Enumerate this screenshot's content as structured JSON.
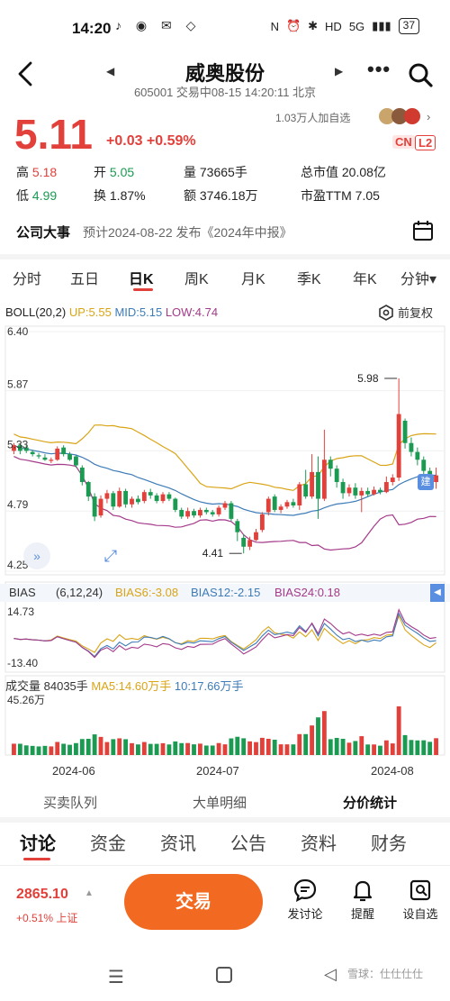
{
  "status": {
    "time": "14:20",
    "network": "5G",
    "battery": "37"
  },
  "header": {
    "stock_name": "威奥股份",
    "sub": "605001 交易中08-15 14:20:11 北京"
  },
  "quote": {
    "price": "5.11",
    "change": "+0.03 +0.59%",
    "watchers": "1.03万人加自选",
    "tag_cn": "CN",
    "tag_l2": "L2"
  },
  "metrics": {
    "high_label": "高",
    "high": "5.18",
    "open_label": "开",
    "open": "5.05",
    "volume": "量 73665手",
    "market_cap": "总市值 20.08亿",
    "low_label": "低",
    "low": "4.99",
    "turnover": "换 1.87%",
    "amount": "额 3746.18万",
    "pe": "市盈TTM 7.05"
  },
  "event": {
    "title": "公司大事",
    "text": "预计2024-08-22 发布《2024年中报》"
  },
  "period_tabs": [
    "分时",
    "五日",
    "日K",
    "周K",
    "月K",
    "季K",
    "年K",
    "分钟▾"
  ],
  "chart": {
    "boll_name": "BOLL(20,2)",
    "boll_up": "UP:5.55",
    "boll_mid": "MID:5.15",
    "boll_low": "LOW:4.74",
    "fq": "前复权",
    "bias_name": "BIAS",
    "bias_params": "(6,12,24)",
    "bias6": "BIAS6:-3.08",
    "bias12": "BIAS12:-2.15",
    "bias24": "BIAS24:0.18",
    "vol_name": "成交量",
    "vol_val": "84035手",
    "vol_ma5": "MA5:14.60万手",
    "vol_ma10": "10:17.66万手",
    "build_badge": "建"
  },
  "chart_data": {
    "type": "candlestick",
    "price_axis_ticks": [
      "6.40",
      "5.87",
      "5.33",
      "4.79",
      "4.25"
    ],
    "ylim": [
      4.25,
      6.4
    ],
    "annotations": [
      {
        "label": "5.98",
        "value": 5.98
      },
      {
        "label": "4.41",
        "value": 4.41
      }
    ],
    "bias_axis_ticks": [
      "14.73",
      "-13.40"
    ],
    "volume_axis_ticks": [
      "45.26万"
    ],
    "x_tick_labels": [
      "2024-06",
      "2024-07",
      "2024-08"
    ],
    "candles": [
      {
        "o": 5.33,
        "c": 5.38,
        "h": 5.4,
        "l": 5.3
      },
      {
        "o": 5.38,
        "c": 5.33,
        "h": 5.4,
        "l": 5.3
      },
      {
        "o": 5.36,
        "c": 5.33,
        "h": 5.38,
        "l": 5.31
      },
      {
        "o": 5.32,
        "c": 5.3,
        "h": 5.34,
        "l": 5.28
      },
      {
        "o": 5.29,
        "c": 5.28,
        "h": 5.31,
        "l": 5.26
      },
      {
        "o": 5.27,
        "c": 5.25,
        "h": 5.3,
        "l": 5.24
      },
      {
        "o": 5.24,
        "c": 5.25,
        "h": 5.27,
        "l": 5.22
      },
      {
        "o": 5.25,
        "c": 5.35,
        "h": 5.37,
        "l": 5.24
      },
      {
        "o": 5.36,
        "c": 5.3,
        "h": 5.38,
        "l": 5.28
      },
      {
        "o": 5.3,
        "c": 5.25,
        "h": 5.32,
        "l": 5.24
      },
      {
        "o": 5.28,
        "c": 5.2,
        "h": 5.29,
        "l": 5.18
      },
      {
        "o": 5.18,
        "c": 5.05,
        "h": 5.2,
        "l": 5.02
      },
      {
        "o": 5.05,
        "c": 4.92,
        "h": 5.06,
        "l": 4.88
      },
      {
        "o": 4.92,
        "c": 4.74,
        "h": 4.95,
        "l": 4.7
      },
      {
        "o": 4.75,
        "c": 4.9,
        "h": 4.93,
        "l": 4.73
      },
      {
        "o": 4.9,
        "c": 4.95,
        "h": 4.98,
        "l": 4.86
      },
      {
        "o": 4.95,
        "c": 4.83,
        "h": 4.97,
        "l": 4.8
      },
      {
        "o": 4.83,
        "c": 4.97,
        "h": 5.0,
        "l": 4.82
      },
      {
        "o": 4.97,
        "c": 4.85,
        "h": 4.99,
        "l": 4.82
      },
      {
        "o": 4.85,
        "c": 4.9,
        "h": 4.92,
        "l": 4.82
      },
      {
        "o": 4.9,
        "c": 4.87,
        "h": 4.93,
        "l": 4.85
      },
      {
        "o": 4.88,
        "c": 4.96,
        "h": 4.98,
        "l": 4.86
      },
      {
        "o": 4.96,
        "c": 4.93,
        "h": 4.99,
        "l": 4.9
      },
      {
        "o": 4.93,
        "c": 4.88,
        "h": 4.95,
        "l": 4.86
      },
      {
        "o": 4.88,
        "c": 4.94,
        "h": 4.96,
        "l": 4.86
      },
      {
        "o": 4.94,
        "c": 4.9,
        "h": 4.96,
        "l": 4.88
      },
      {
        "o": 4.9,
        "c": 4.8,
        "h": 4.91,
        "l": 4.78
      },
      {
        "o": 4.8,
        "c": 4.74,
        "h": 4.82,
        "l": 4.72
      },
      {
        "o": 4.74,
        "c": 4.79,
        "h": 4.82,
        "l": 4.72
      },
      {
        "o": 4.79,
        "c": 4.75,
        "h": 4.81,
        "l": 4.73
      },
      {
        "o": 4.75,
        "c": 4.8,
        "h": 4.82,
        "l": 4.73
      },
      {
        "o": 4.8,
        "c": 4.78,
        "h": 4.82,
        "l": 4.76
      },
      {
        "o": 4.78,
        "c": 4.76,
        "h": 4.8,
        "l": 4.74
      },
      {
        "o": 4.76,
        "c": 4.82,
        "h": 4.84,
        "l": 4.74
      },
      {
        "o": 4.82,
        "c": 4.86,
        "h": 4.88,
        "l": 4.8
      },
      {
        "o": 4.86,
        "c": 4.72,
        "h": 4.88,
        "l": 4.7
      },
      {
        "o": 4.7,
        "c": 4.6,
        "h": 4.72,
        "l": 4.52
      },
      {
        "o": 4.55,
        "c": 4.47,
        "h": 4.58,
        "l": 4.41
      },
      {
        "o": 4.47,
        "c": 4.53,
        "h": 4.56,
        "l": 4.44
      },
      {
        "o": 4.53,
        "c": 4.6,
        "h": 4.63,
        "l": 4.52
      },
      {
        "o": 4.62,
        "c": 4.76,
        "h": 4.78,
        "l": 4.6
      },
      {
        "o": 4.78,
        "c": 4.9,
        "h": 4.92,
        "l": 4.75
      },
      {
        "o": 4.92,
        "c": 4.8,
        "h": 4.94,
        "l": 4.78
      },
      {
        "o": 4.8,
        "c": 4.83,
        "h": 4.85,
        "l": 4.77
      },
      {
        "o": 4.83,
        "c": 4.87,
        "h": 4.89,
        "l": 4.81
      },
      {
        "o": 4.87,
        "c": 4.84,
        "h": 4.9,
        "l": 4.82
      },
      {
        "o": 4.84,
        "c": 5.03,
        "h": 5.05,
        "l": 4.8
      },
      {
        "o": 5.03,
        "c": 4.92,
        "h": 5.16,
        "l": 4.9
      },
      {
        "o": 4.92,
        "c": 5.14,
        "h": 5.3,
        "l": 4.9
      },
      {
        "o": 5.14,
        "c": 4.9,
        "h": 5.28,
        "l": 4.72
      },
      {
        "o": 4.9,
        "c": 5.25,
        "h": 5.52,
        "l": 4.88
      },
      {
        "o": 5.25,
        "c": 5.17,
        "h": 5.28,
        "l": 5.1
      },
      {
        "o": 5.17,
        "c": 5.05,
        "h": 5.2,
        "l": 5.0
      },
      {
        "o": 5.05,
        "c": 4.95,
        "h": 5.08,
        "l": 4.9
      },
      {
        "o": 4.95,
        "c": 5.0,
        "h": 5.03,
        "l": 4.92
      },
      {
        "o": 5.0,
        "c": 4.93,
        "h": 5.04,
        "l": 4.9
      },
      {
        "o": 4.93,
        "c": 4.97,
        "h": 5.0,
        "l": 4.78
      },
      {
        "o": 4.97,
        "c": 4.94,
        "h": 5.0,
        "l": 4.92
      },
      {
        "o": 4.94,
        "c": 4.98,
        "h": 5.01,
        "l": 4.93
      },
      {
        "o": 4.98,
        "c": 4.96,
        "h": 5.0,
        "l": 4.94
      },
      {
        "o": 4.96,
        "c": 5.05,
        "h": 5.1,
        "l": 4.95
      },
      {
        "o": 5.05,
        "c": 5.09,
        "h": 5.12,
        "l": 5.02
      },
      {
        "o": 5.09,
        "c": 5.66,
        "h": 5.98,
        "l": 5.06
      },
      {
        "o": 5.6,
        "c": 5.4,
        "h": 5.62,
        "l": 5.35
      },
      {
        "o": 5.4,
        "c": 5.32,
        "h": 5.45,
        "l": 5.28
      },
      {
        "o": 5.32,
        "c": 5.25,
        "h": 5.36,
        "l": 5.2
      },
      {
        "o": 5.25,
        "c": 5.15,
        "h": 5.28,
        "l": 5.12
      },
      {
        "o": 5.15,
        "c": 5.08,
        "h": 5.18,
        "l": 5.05
      },
      {
        "o": 5.05,
        "c": 5.11,
        "h": 5.18,
        "l": 4.99
      }
    ],
    "volume_max": "45.26万"
  },
  "detail_tabs": [
    "买卖队列",
    "大单明细",
    "分价统计"
  ],
  "main_tabs": [
    "讨论",
    "资金",
    "资讯",
    "公告",
    "资料",
    "财务"
  ],
  "footer": {
    "index_value": "2865.10",
    "index_change": "+0.51% 上证",
    "trade": "交易",
    "post": "发讨论",
    "alert": "提醒",
    "watch": "设自选"
  },
  "watermark": "雪球：仕仕仕仕"
}
